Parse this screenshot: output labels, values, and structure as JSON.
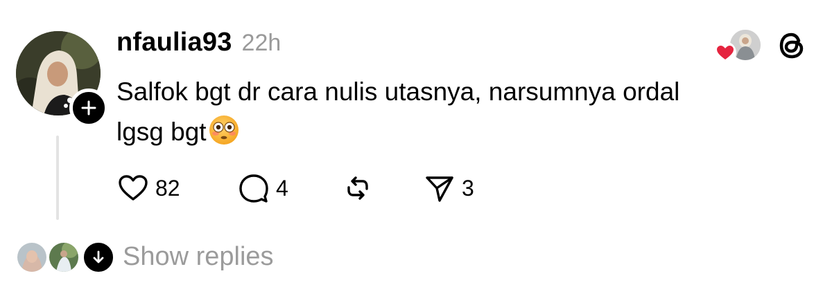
{
  "post": {
    "username": "nfaulia93",
    "timestamp": "22h",
    "text_line1": "Salfok bgt dr cara nulis utasnya, narsumnya ordal",
    "text_line2": "lgsg bgt",
    "emoji": "flushed-face"
  },
  "actions": {
    "like_count": "82",
    "reply_count": "4",
    "share_count": "3"
  },
  "replies": {
    "label": "Show replies"
  },
  "colors": {
    "heart": "#e5243f",
    "muted_text": "#9a9a9a",
    "thread_line": "#e3e3e3"
  }
}
